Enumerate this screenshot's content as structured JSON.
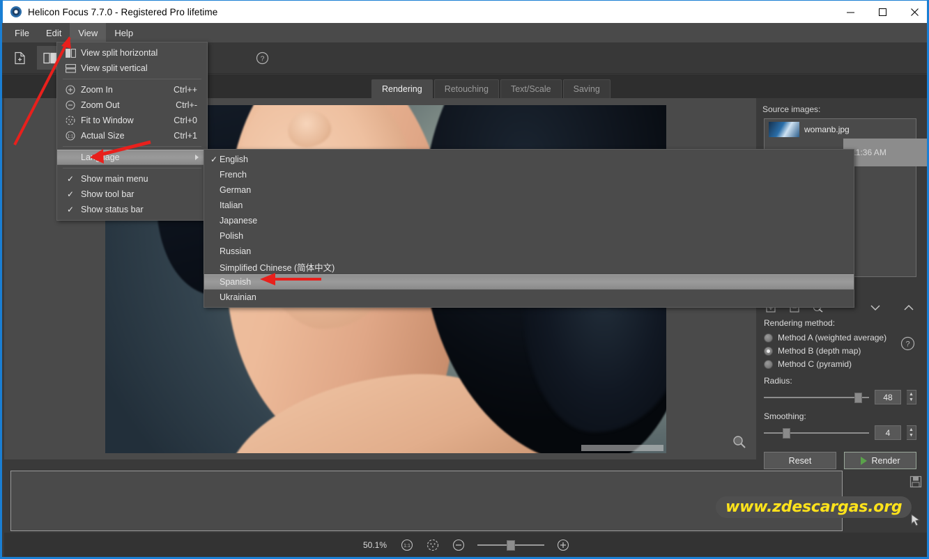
{
  "window": {
    "title": "Helicon Focus 7.7.0 - Registered Pro lifetime",
    "logo_icon": "helicon-logo-icon",
    "minimize_label": "–",
    "maximize_label": "□",
    "close_label": "✕"
  },
  "menubar": {
    "items": [
      {
        "label": "File"
      },
      {
        "label": "Edit"
      },
      {
        "label": "View"
      },
      {
        "label": "Help"
      }
    ],
    "active": "View"
  },
  "toolbar": {
    "buttons": [
      {
        "name": "add-images-icon"
      },
      {
        "name": "view-split-horizontal-icon"
      },
      {
        "name": "help-icon"
      }
    ]
  },
  "tabs": [
    {
      "label": "Rendering",
      "active": true
    },
    {
      "label": "Retouching",
      "active": false
    },
    {
      "label": "Text/Scale",
      "active": false
    },
    {
      "label": "Saving",
      "active": false
    }
  ],
  "view_menu": {
    "items": [
      {
        "label": "View split horizontal",
        "shortcut": "",
        "icon": "split-horizontal-icon",
        "check": "",
        "highlight": false,
        "submenu": false
      },
      {
        "label": "View split vertical",
        "shortcut": "",
        "icon": "split-vertical-icon",
        "check": "",
        "highlight": false,
        "submenu": false
      },
      {
        "separator": true
      },
      {
        "label": "Zoom In",
        "shortcut": "Ctrl++",
        "icon": "zoom-in-icon",
        "check": "",
        "highlight": false,
        "submenu": false
      },
      {
        "label": "Zoom Out",
        "shortcut": "Ctrl+-",
        "icon": "zoom-out-icon",
        "check": "",
        "highlight": false,
        "submenu": false
      },
      {
        "label": "Fit to Window",
        "shortcut": "Ctrl+0",
        "icon": "fit-to-window-icon",
        "check": "",
        "highlight": false,
        "submenu": false
      },
      {
        "label": "Actual Size",
        "shortcut": "Ctrl+1",
        "icon": "actual-size-icon",
        "check": "",
        "highlight": false,
        "submenu": false
      },
      {
        "separator": true
      },
      {
        "label": "Language",
        "shortcut": "",
        "icon": "",
        "check": "",
        "highlight": true,
        "submenu": true
      },
      {
        "separator": true
      },
      {
        "label": "Show main menu",
        "shortcut": "",
        "icon": "",
        "check": "✓",
        "highlight": false,
        "submenu": false
      },
      {
        "label": "Show tool bar",
        "shortcut": "",
        "icon": "",
        "check": "✓",
        "highlight": false,
        "submenu": false
      },
      {
        "label": "Show status bar",
        "shortcut": "",
        "icon": "",
        "check": "✓",
        "highlight": false,
        "submenu": false
      }
    ]
  },
  "language_menu": {
    "items": [
      {
        "label": "English",
        "check": "✓",
        "highlight": false
      },
      {
        "label": "French",
        "check": "",
        "highlight": false
      },
      {
        "label": "German",
        "check": "",
        "highlight": false
      },
      {
        "label": "Italian",
        "check": "",
        "highlight": false
      },
      {
        "label": "Japanese",
        "check": "",
        "highlight": false
      },
      {
        "label": "Polish",
        "check": "",
        "highlight": false
      },
      {
        "label": "Russian",
        "check": "",
        "highlight": false
      },
      {
        "label": "Simplified Chinese (简体中文)",
        "check": "",
        "highlight": false
      },
      {
        "label": "Spanish",
        "check": "",
        "highlight": true
      },
      {
        "label": "Ukrainian",
        "check": "",
        "highlight": false
      }
    ]
  },
  "right_panel": {
    "source_images_label": "Source images:",
    "source_items": [
      {
        "filename": "womanb.jpg",
        "thumb": "image-thumbnail"
      }
    ],
    "tooltip_text": "11:36 AM",
    "icons": [
      {
        "name": "add-to-stack-icon"
      },
      {
        "name": "remove-from-stack-icon"
      },
      {
        "name": "refresh-stack-icon"
      },
      {
        "name": "chevron-down-icon"
      },
      {
        "name": "chevron-up-icon"
      }
    ],
    "rendering_method_label": "Rendering method:",
    "methods": [
      {
        "label": "Method A (weighted average)",
        "selected": false
      },
      {
        "label": "Method B (depth map)",
        "selected": true
      },
      {
        "label": "Method C (pyramid)",
        "selected": false
      }
    ],
    "radius_label": "Radius:",
    "radius_value": "48",
    "radius_percent": 86,
    "smoothing_label": "Smoothing:",
    "smoothing_value": "4",
    "smoothing_percent": 18,
    "reset_label": "Reset",
    "render_label": "Render",
    "help_icon": "help-icon"
  },
  "viewport": {
    "magnifier_icon": "magnifier-icon",
    "image_name": "womanb.jpg"
  },
  "filmstrip": {
    "save_icon": "save-icon"
  },
  "watermark": {
    "text": "www.zdescargas.org",
    "color": "#ffe31b"
  },
  "statusbar": {
    "zoom_text": "50.1%",
    "actual_size_icon": "actual-size-icon",
    "fit_to_window_icon": "fit-to-window-icon",
    "zoom_out_icon": "zoom-out-icon",
    "zoom_in_icon": "zoom-in-icon",
    "slider_percent": 44
  },
  "annotations": {
    "accent_red": "#e8201c",
    "arrows": [
      {
        "name": "arrow-to-view-menu"
      },
      {
        "name": "arrow-to-language-item"
      },
      {
        "name": "arrow-to-spanish-item"
      }
    ]
  },
  "colors": {
    "window_border": "#1a7fd4",
    "panel_bg": "#3a3a3a",
    "viewport_bg": "#4a4a4a",
    "menu_bg": "#4b4b4b",
    "highlight": "#9a9a9a"
  }
}
